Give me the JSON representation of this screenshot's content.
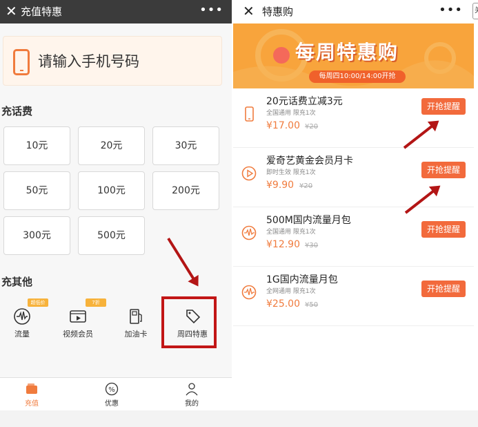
{
  "left": {
    "nav": {
      "title": "充值特惠",
      "close": "✕",
      "more": "•••"
    },
    "phone_placeholder": "请输入手机号码",
    "topup_section": "充话费",
    "amounts": [
      "10元",
      "20元",
      "30元",
      "50元",
      "100元",
      "200元",
      "300元",
      "500元"
    ],
    "other_section": "充其他",
    "others": [
      {
        "label": "流量",
        "badge": "超低价"
      },
      {
        "label": "视频会员",
        "badge": "7折"
      },
      {
        "label": "加油卡",
        "badge": ""
      },
      {
        "label": "周四特惠",
        "badge": ""
      }
    ],
    "tabs": [
      "充值",
      "优惠",
      "我的"
    ]
  },
  "right": {
    "nav": {
      "title": "特惠购",
      "close": "✕",
      "more": "•••",
      "edge": "关"
    },
    "banner": {
      "title": "每周特惠购",
      "subtitle": "每周四10:00/14:00开抢"
    },
    "items": [
      {
        "name": "20元话费立减3元",
        "desc": "全国通用 限充1次",
        "price": "¥17.00",
        "orig": "¥20",
        "button": "开抢提醒",
        "icon": "phone-icon"
      },
      {
        "name": "爱奇艺黄金会员月卡",
        "desc": "即时生效 限充1次",
        "price": "¥9.90",
        "orig": "¥20",
        "button": "开抢提醒",
        "icon": "play-icon"
      },
      {
        "name": "500M国内流量月包",
        "desc": "全国通用 限充1次",
        "price": "¥12.90",
        "orig": "¥30",
        "button": "开抢提醒",
        "icon": "data-wave-icon"
      },
      {
        "name": "1G国内流量月包",
        "desc": "全网通用 限充1次",
        "price": "¥25.00",
        "orig": "¥50",
        "button": "开抢提醒",
        "icon": "data-wave-icon"
      }
    ]
  },
  "colors": {
    "accent": "#f07b3d",
    "button": "#f26a3c",
    "annotation": "#c21616",
    "nav_dark": "#3b3b3b",
    "banner": "#f8a43c"
  }
}
